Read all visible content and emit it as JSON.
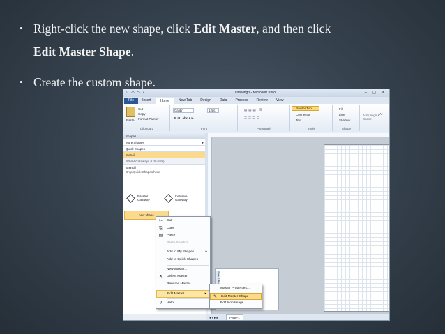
{
  "slide": {
    "bullet1_line1_pre": "Right-click the new shape, click ",
    "bullet1_line1_bold": "Edit Master",
    "bullet1_line1_post": ", and then click",
    "bullet1_line2_bold": "Edit Master Shape",
    "bullet1_line2_post": ".",
    "bullet2": "Create the custom shape.",
    "bullet_glyph": "•"
  },
  "colors": {
    "frame": "#c8a23a",
    "highlight": "#fbd98d",
    "file_tab": "#2b5797"
  },
  "visio": {
    "title": "Drawing3 - Microsoft Visio",
    "qat": "⎌ ↶ ↷ ▾",
    "window_buttons": "– ▢ ✕",
    "tabs": [
      "File",
      "Insert",
      "Home",
      "New Tab",
      "Design",
      "Data",
      "Process",
      "Review",
      "View"
    ],
    "active_tab": "Home",
    "ribbon": {
      "paste": "Paste",
      "cut": "Cut",
      "copy": "Copy",
      "format_painter": "Format Painter",
      "clipboard": "Clipboard",
      "font_name": "Calibri",
      "font_size": "12pt.",
      "font_format": "B  I  U  abc  Aa-",
      "font_group": "Font",
      "paragraph_group": "Paragraph",
      "pointer_tool": "Pointer Tool",
      "connector": "Connector",
      "text": "Text",
      "tools_group": "Tools",
      "fill": "Fill",
      "line": "Line",
      "shadow": "Shadow",
      "shape_group": "Shape",
      "auto_align": "Auto Align & Space",
      "arrange": "Ar"
    },
    "shapes_pane": {
      "header": "Shapes",
      "more_shapes": "More Shapes",
      "quick_shapes": "Quick Shapes",
      "stencil": "Stencil",
      "bpmn": "BPMN Gateways (US units)",
      "stencil_title": "Stencil",
      "drop_hint": "Drop Quick Shapes here",
      "gateway1_line1": "Parallel",
      "gateway1_line2": "Gateway",
      "gateway2_line1": "Inclusive",
      "gateway2_line2": "Gateway",
      "new_shape": "new shape"
    },
    "context_menu": [
      {
        "label": "Cut",
        "icon": "✂",
        "disabled": false
      },
      {
        "label": "Copy",
        "icon": "⎘",
        "disabled": false
      },
      {
        "label": "Paste",
        "icon": "▤",
        "disabled": false
      },
      {
        "label": "Paste Shortcut",
        "icon": "",
        "disabled": true
      },
      {
        "label": "Add to My Shapes",
        "icon": "",
        "disabled": false,
        "submenu": true
      },
      {
        "label": "Add to Quick Shapes",
        "icon": "",
        "disabled": false
      },
      {
        "label": "New Master...",
        "icon": "",
        "disabled": false
      },
      {
        "label": "Delete Master",
        "icon": "✕",
        "disabled": false
      },
      {
        "label": "Rename Master",
        "icon": "",
        "disabled": false
      },
      {
        "label": "Edit Master",
        "icon": "",
        "disabled": false,
        "submenu": true,
        "highlighted": true
      },
      {
        "label": "Help",
        "icon": "?",
        "disabled": false
      }
    ],
    "submenu": [
      {
        "label": "Master Properties...",
        "icon": ""
      },
      {
        "label": "Edit Master Shape",
        "icon": "✎",
        "highlighted": true
      },
      {
        "label": "Edit Icon Image",
        "icon": ""
      }
    ],
    "side_window": "Size & Pos",
    "page_tab": "Page-1",
    "submenu_arrow": "▸"
  }
}
